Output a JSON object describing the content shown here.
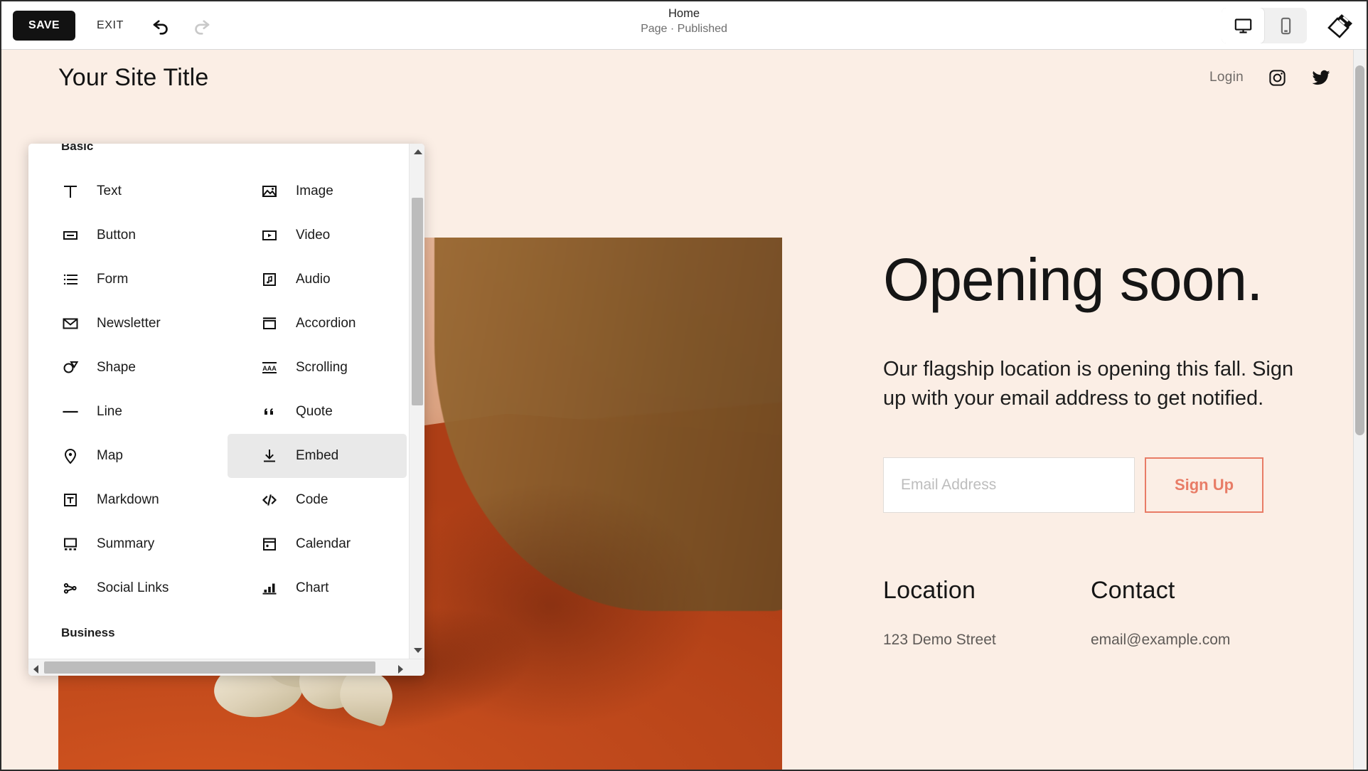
{
  "editor": {
    "save_label": "SAVE",
    "exit_label": "EXIT",
    "undo_icon": "undo-arrow-icon",
    "redo_icon": "redo-arrow-icon",
    "page_title": "Home",
    "page_status": "Page · Published",
    "device_desktop_icon": "desktop-monitor-icon",
    "device_mobile_icon": "mobile-phone-icon",
    "brush_icon": "paintbrush-icon",
    "active_device": "mobile"
  },
  "picker": {
    "groups": [
      {
        "label": "Basic"
      },
      {
        "label": "Business"
      }
    ],
    "items": [
      {
        "label": "Text",
        "icon": "text-icon",
        "hovered": false
      },
      {
        "label": "Image",
        "icon": "image-icon",
        "hovered": false
      },
      {
        "label": "Button",
        "icon": "button-icon",
        "hovered": false
      },
      {
        "label": "Video",
        "icon": "video-icon",
        "hovered": false
      },
      {
        "label": "Form",
        "icon": "form-list-icon",
        "hovered": false
      },
      {
        "label": "Audio",
        "icon": "audio-note-icon",
        "hovered": false
      },
      {
        "label": "Newsletter",
        "icon": "envelope-icon",
        "hovered": false
      },
      {
        "label": "Accordion",
        "icon": "accordion-icon",
        "hovered": false
      },
      {
        "label": "Shape",
        "icon": "shape-icon",
        "hovered": false
      },
      {
        "label": "Scrolling",
        "icon": "scrolling-text-icon",
        "hovered": false
      },
      {
        "label": "Line",
        "icon": "line-icon",
        "hovered": false
      },
      {
        "label": "Quote",
        "icon": "quote-icon",
        "hovered": false
      },
      {
        "label": "Map",
        "icon": "map-pin-icon",
        "hovered": false
      },
      {
        "label": "Embed",
        "icon": "embed-download-icon",
        "hovered": true
      },
      {
        "label": "Markdown",
        "icon": "markdown-icon",
        "hovered": false
      },
      {
        "label": "Code",
        "icon": "code-icon",
        "hovered": false
      },
      {
        "label": "Summary",
        "icon": "summary-icon",
        "hovered": false
      },
      {
        "label": "Calendar",
        "icon": "calendar-icon",
        "hovered": false
      },
      {
        "label": "Social Links",
        "icon": "social-links-icon",
        "hovered": false
      },
      {
        "label": "Chart",
        "icon": "chart-bar-icon",
        "hovered": false
      }
    ]
  },
  "site": {
    "title": "Your Site Title",
    "nav": {
      "login_label": "Login",
      "instagram_icon": "instagram-icon",
      "twitter_icon": "twitter-icon"
    },
    "hero": {
      "heading": "Opening soon.",
      "subtext": "Our flagship location is opening this fall. Sign up with your email address to get notified.",
      "email_placeholder": "Email Address",
      "email_value": "",
      "signup_label": "Sign Up",
      "image_alt": "ginger-root-on-terracotta-cloth-photo"
    },
    "columns": [
      {
        "heading": "Location",
        "body": "123 Demo Street"
      },
      {
        "heading": "Contact",
        "body": "email@example.com"
      }
    ],
    "colors": {
      "background": "#fbeee5",
      "accent": "#e87c66",
      "text": "#151515"
    }
  }
}
